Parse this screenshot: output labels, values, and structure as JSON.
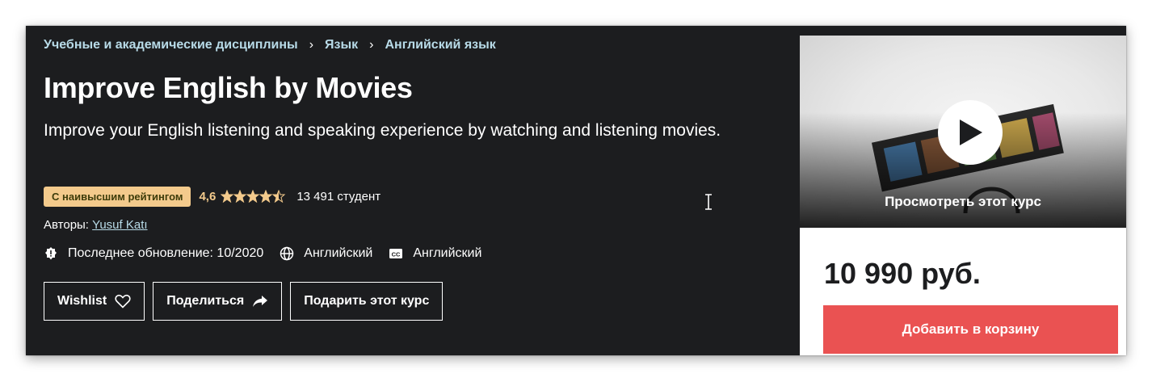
{
  "breadcrumb": {
    "items": [
      "Учебные и академические дисциплины",
      "Язык",
      "Английский язык"
    ]
  },
  "course": {
    "title": "Improve English by Movies",
    "subtitle": "Improve your English listening and speaking experience by watching and listening movies.",
    "badge": "С наивысшим рейтингом",
    "rating": "4,6",
    "rating_stars": 4.5,
    "students": "13 491 студент",
    "authors_label": "Авторы:",
    "author": "Yusuf Katı",
    "last_update": "Последнее обновление: 10/2020",
    "language": "Английский",
    "captions": "Английский"
  },
  "actions": {
    "wishlist": "Wishlist",
    "share": "Поделиться",
    "gift": "Подарить этот курс"
  },
  "sidebar": {
    "preview_label": "Просмотреть этот курс",
    "price": "10 990 руб.",
    "add_to_cart": "Добавить в корзину"
  },
  "colors": {
    "background": "#1c1d1f",
    "badge": "#f3ca8c",
    "link": "#b8dbe8",
    "cart_button": "#ea5252"
  }
}
